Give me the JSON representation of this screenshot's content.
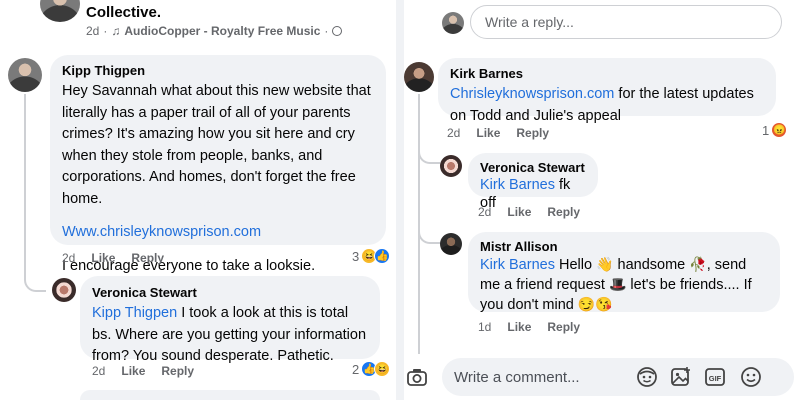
{
  "post_header": {
    "title": "Collective.",
    "meta_time": "2d",
    "meta_music": "AudioCopper - Royalty Free Music"
  },
  "left_panel": {
    "comment_kipp": {
      "author": "Kipp Thigpen",
      "text": "Hey Savannah what about this new website that literally has a paper trail of all of your parents crimes? It's amazing how you sit here and cry when they stole from people, banks, and corporations. And homes, don't forget the free home.",
      "link": "Www.chrisleyknowsprison.com",
      "closing": "I encourage everyone to take a looksie.",
      "time": "2d",
      "like_label": "Like",
      "reply_label": "Reply",
      "reaction_count": "3"
    },
    "reply_veronica": {
      "author": "Veronica Stewart",
      "mention": "Kipp Thigpen",
      "text": " I took a look at this is total bs. Where are you getting your information from? You sound desperate.  Pathetic.",
      "time": "2d",
      "like_label": "Like",
      "reply_label": "Reply",
      "reaction_count": "2"
    }
  },
  "right_panel": {
    "top_reply_placeholder": "Write a reply...",
    "comment_kirk": {
      "author": "Kirk Barnes",
      "link": "Chrisleyknowsprison.com",
      "text": " for the latest updates on Todd and Julie's appeal",
      "time": "2d",
      "like_label": "Like",
      "reply_label": "Reply",
      "reaction_count": "1"
    },
    "reply_veronica": {
      "author": "Veronica Stewart",
      "mention": "Kirk Barnes",
      "text": " fk off",
      "time": "2d",
      "like_label": "Like",
      "reply_label": "Reply"
    },
    "reply_mistr": {
      "author": "Mistr Allison",
      "mention": "Kirk Barnes",
      "text_1": " Hello ",
      "text_2": " handsome ",
      "text_3": ", send me a friend request ",
      "text_4": " let's be friends.... If you don't mind ",
      "time": "1d",
      "like_label": "Like",
      "reply_label": "Reply"
    },
    "comment_placeholder": "Write a comment..."
  },
  "colors": {
    "link": "#216fdb",
    "bubble": "#f0f2f5",
    "meta": "#65676b"
  }
}
